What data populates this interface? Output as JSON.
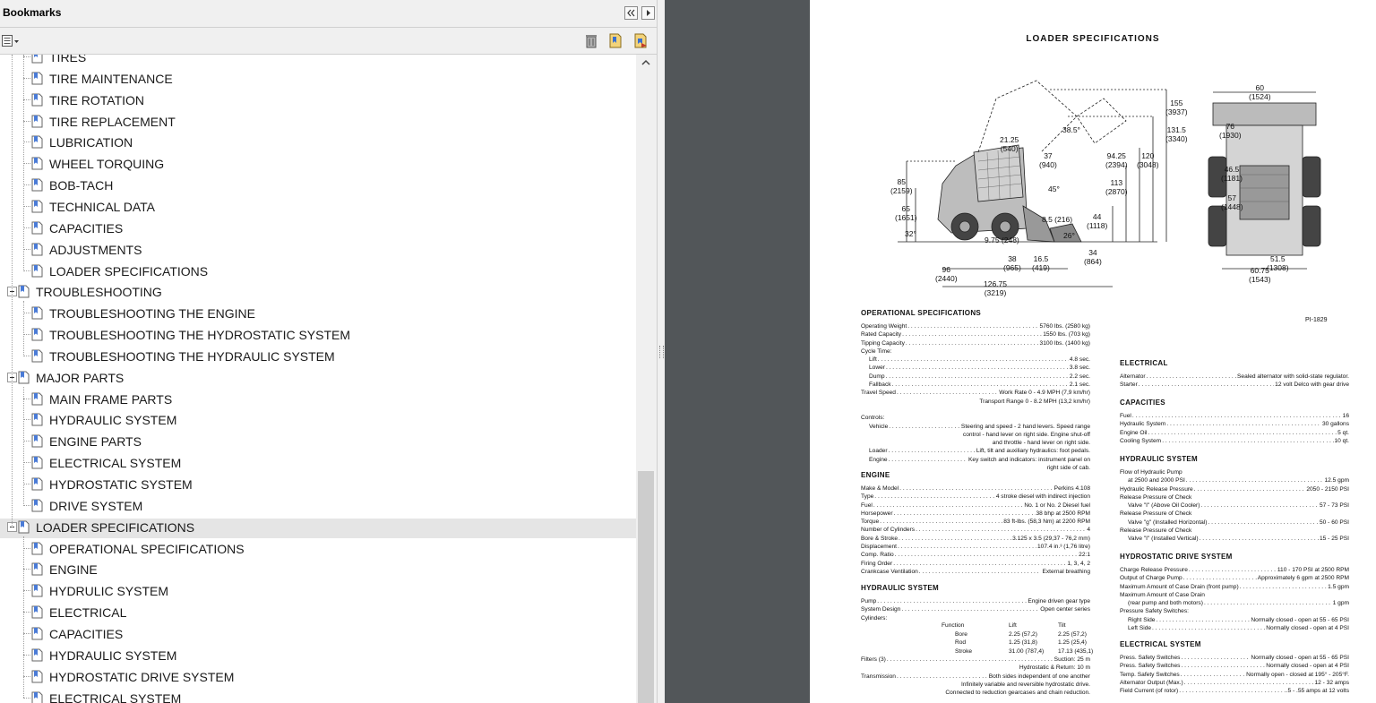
{
  "bookmarks_panel": {
    "title": "Bookmarks",
    "items": [
      {
        "label": "TIRES",
        "level": 1
      },
      {
        "label": "TIRE MAINTENANCE",
        "level": 1
      },
      {
        "label": "TIRE ROTATION",
        "level": 1
      },
      {
        "label": "TIRE REPLACEMENT",
        "level": 1
      },
      {
        "label": "LUBRICATION",
        "level": 1
      },
      {
        "label": "WHEEL TORQUING",
        "level": 1
      },
      {
        "label": "BOB-TACH",
        "level": 1
      },
      {
        "label": "TECHNICAL DATA",
        "level": 1
      },
      {
        "label": "CAPACITIES",
        "level": 1
      },
      {
        "label": "ADJUSTMENTS",
        "level": 1
      },
      {
        "label": "LOADER SPECIFICATIONS",
        "level": 1
      },
      {
        "label": "TROUBLESHOOTING",
        "level": 0
      },
      {
        "label": "TROUBLESHOOTING THE ENGINE",
        "level": 1
      },
      {
        "label": "TROUBLESHOOTING THE HYDROSTATIC SYSTEM",
        "level": 1
      },
      {
        "label": "TROUBLESHOOTING THE HYDRAULIC SYSTEM",
        "level": 1
      },
      {
        "label": "MAJOR PARTS",
        "level": 0
      },
      {
        "label": "MAIN FRAME PARTS",
        "level": 1
      },
      {
        "label": "HYDRAULIC SYSTEM",
        "level": 1
      },
      {
        "label": "ENGINE PARTS",
        "level": 1
      },
      {
        "label": "ELECTRICAL SYSTEM",
        "level": 1
      },
      {
        "label": "HYDROSTATIC SYSTEM",
        "level": 1
      },
      {
        "label": "DRIVE SYSTEM",
        "level": 1
      },
      {
        "label": "LOADER SPECIFICATIONS",
        "level": 0,
        "selected": true
      },
      {
        "label": "OPERATIONAL SPECIFICATIONS",
        "level": 1
      },
      {
        "label": "ENGINE",
        "level": 1
      },
      {
        "label": "HYDRULIC SYSTEM",
        "level": 1
      },
      {
        "label": "ELECTRICAL",
        "level": 1
      },
      {
        "label": "CAPACITIES",
        "level": 1
      },
      {
        "label": "HYDRAULIC SYSTEM",
        "level": 1
      },
      {
        "label": "HYDROSTATIC DRIVE SYSTEM",
        "level": 1
      },
      {
        "label": "ELECTRICAL SYSTEM",
        "level": 1
      }
    ]
  },
  "icons": {
    "options": "options-icon",
    "delete": "trash-icon",
    "new_bookmark": "new-bookmark-icon",
    "bookmark_from_selection": "bookmark-from-selection-icon",
    "collapse": "double-chevron-left-icon",
    "menu": "play-right-icon"
  },
  "document": {
    "title": "LOADER  SPECIFICATIONS",
    "figure_code": "PI-1829",
    "dimensions": [
      {
        "text": "155\n(3937)",
        "l": 397,
        "t": 110
      },
      {
        "text": "131.5\n(3340)",
        "l": 397,
        "t": 140
      },
      {
        "text": "120\n(3048)",
        "l": 365,
        "t": 169
      },
      {
        "text": "94.25\n(2394)",
        "l": 330,
        "t": 169
      },
      {
        "text": "113\n(2870)",
        "l": 330,
        "t": 199
      },
      {
        "text": "38.5°",
        "l": 282,
        "t": 140
      },
      {
        "text": "21.25\n(540)",
        "l": 212,
        "t": 151
      },
      {
        "text": "37\n(940)",
        "l": 256,
        "t": 169
      },
      {
        "text": "45°",
        "l": 266,
        "t": 206
      },
      {
        "text": "85\n(2159)",
        "l": 90,
        "t": 198
      },
      {
        "text": "65\n(1651)",
        "l": 95,
        "t": 228
      },
      {
        "text": "32°",
        "l": 106,
        "t": 256
      },
      {
        "text": "8.5 (216)",
        "l": 259,
        "t": 240
      },
      {
        "text": "44\n(1118)",
        "l": 309,
        "t": 237
      },
      {
        "text": "26°",
        "l": 283,
        "t": 258
      },
      {
        "text": "9.75 (248)",
        "l": 195,
        "t": 263
      },
      {
        "text": "38\n(965)",
        "l": 216,
        "t": 284
      },
      {
        "text": "16.5\n(419)",
        "l": 248,
        "t": 284
      },
      {
        "text": "34\n(864)",
        "l": 306,
        "t": 277
      },
      {
        "text": "96\n(2440)",
        "l": 140,
        "t": 296
      },
      {
        "text": "126.75\n(3219)",
        "l": 194,
        "t": 312
      },
      {
        "text": "60\n(1524)",
        "l": 490,
        "t": 93
      },
      {
        "text": "76\n(1930)",
        "l": 457,
        "t": 136
      },
      {
        "text": "46.5\n(1181)",
        "l": 459,
        "t": 184
      },
      {
        "text": "57\n(1448)",
        "l": 459,
        "t": 216
      },
      {
        "text": "51.5\n(1308)",
        "l": 510,
        "t": 284
      },
      {
        "text": "60.75\n(1543)",
        "l": 490,
        "t": 297
      }
    ],
    "operational": {
      "title": "OPERATIONAL SPECIFICATIONS",
      "rows": [
        {
          "k": "Operating Weight",
          "v": "5760 lbs. (2580 kg)"
        },
        {
          "k": "Rated Capacity",
          "v": "1550 lbs. (703 kg)"
        },
        {
          "k": "Tipping Capacity",
          "v": "3100 lbs. (1400 kg)"
        },
        {
          "k": "Cycle Time:",
          "v": ""
        },
        {
          "k": "Lift",
          "v": "4.8 sec.",
          "indent": true
        },
        {
          "k": "Lower",
          "v": "3.8 sec.",
          "indent": true
        },
        {
          "k": "Dump",
          "v": "2.2 sec.",
          "indent": true
        },
        {
          "k": "Fallback",
          "v": "2.1 sec.",
          "indent": true
        },
        {
          "k": "Travel Speed",
          "v": "Work Rate 0 - 4.9 MPH (7,9 km/hr)"
        },
        {
          "k": "",
          "v": "Transport Range 0 - 8.2 MPH (13,2 km/hr)",
          "cont": true
        },
        {
          "k": "",
          "v": "",
          "cont": true
        },
        {
          "k": "Controls:",
          "v": ""
        },
        {
          "k": "Vehicle",
          "v": "Steering and speed - 2 hand levers. Speed range",
          "indent": true
        },
        {
          "k": "",
          "v": "control - hand lever on right side. Engine shut-off",
          "cont": true
        },
        {
          "k": "",
          "v": "and throttle - hand lever on right side.",
          "cont": true
        },
        {
          "k": "Loader",
          "v": "Lift, tilt and auxiliary hydraulics: foot pedals.",
          "indent": true
        },
        {
          "k": "Engine",
          "v": "Key switch and indicators: instrument panel on",
          "indent": true
        },
        {
          "k": "",
          "v": "right side of cab.",
          "cont": true
        }
      ]
    },
    "engine": {
      "title": "ENGINE",
      "rows": [
        {
          "k": "Make & Model",
          "v": "Perkins 4.108"
        },
        {
          "k": "Type",
          "v": "4 stroke diesel with indirect injection"
        },
        {
          "k": "Fuel",
          "v": "No. 1 or No. 2 Diesel fuel"
        },
        {
          "k": "Horsepower",
          "v": "38 bhp at 2500 RPM"
        },
        {
          "k": "Torque",
          "v": "83 ft-lbs. (58,3 Nm) at 2200 RPM"
        },
        {
          "k": "Number of Cylinders",
          "v": "4"
        },
        {
          "k": "Bore & Stroke",
          "v": "3.125 x 3.5 (29,37 - 76,2 mm)"
        },
        {
          "k": "Displacement",
          "v": "107.4 in.³ (1,76 litre)"
        },
        {
          "k": "Comp. Ratio",
          "v": "22:1"
        },
        {
          "k": "Firing Order",
          "v": "1, 3, 4, 2"
        },
        {
          "k": "Crankcase Ventilation",
          "v": "External breathing"
        }
      ]
    },
    "hydraulic_left": {
      "title": "HYDRAULIC SYSTEM",
      "rows": [
        {
          "k": "Pump",
          "v": "Engine driven gear type"
        },
        {
          "k": "System Design",
          "v": "Open center series"
        },
        {
          "k": "Cylinders:",
          "v": ""
        }
      ],
      "cyl_header": [
        "Function",
        "Lift",
        "Tilt"
      ],
      "cyl_rows": [
        [
          "Bore",
          "2.25 (57,2)",
          "2.25 (57,2)"
        ],
        [
          "Rod",
          "1.25 (31,8)",
          "1.25 (25,4)"
        ],
        [
          "Stroke",
          "31.00 (787,4)",
          "17.13 (435,1)"
        ]
      ],
      "rows2": [
        {
          "k": "Filters (3)",
          "v": "Suction: 25 m"
        },
        {
          "k": "",
          "v": "Hydrostatic & Return: 10 m",
          "cont": true
        },
        {
          "k": "Transmission",
          "v": "Both sides independent of one another"
        },
        {
          "k": "",
          "v": "Infinitely variable and reversible hydrostatic drive.",
          "cont": true
        },
        {
          "k": "",
          "v": "Connected to reduction gearcases and chain reduction.",
          "cont": true
        }
      ]
    },
    "electrical": {
      "title": "ELECTRICAL",
      "rows": [
        {
          "k": "Alternator",
          "v": "Sealed alternator with solid-state regulator."
        },
        {
          "k": "Starter",
          "v": "12 volt Delco with gear drive"
        }
      ]
    },
    "capacities": {
      "title": "CAPACITIES",
      "rows": [
        {
          "k": "Fuel",
          "v": "16"
        },
        {
          "k": "Hydraulic System",
          "v": "30 gallons"
        },
        {
          "k": "Engine Oil",
          "v": "5 qt."
        },
        {
          "k": "Cooling System",
          "v": "10 qt."
        }
      ]
    },
    "hydraulic_right": {
      "title": "HYDRAULIC SYSTEM",
      "rows": [
        {
          "k": "Flow of Hydraulic Pump",
          "v": ""
        },
        {
          "k": "at 2500 and 2000 PSI",
          "v": "12.5 gpm",
          "indent": true
        },
        {
          "k": "Hydraulic Release Pressure",
          "v": "2050 - 2150 PSI"
        },
        {
          "k": "Release Pressure of Check",
          "v": ""
        },
        {
          "k": "Valve \"I\" (Above Oil Cooler)",
          "v": "57 - 73 PSI",
          "indent": true
        },
        {
          "k": "Release Pressure of Check",
          "v": ""
        },
        {
          "k": "Valve \"g\" (Installed Horizontal)",
          "v": "50 - 60 PSI",
          "indent": true
        },
        {
          "k": "Release Pressure of Check",
          "v": ""
        },
        {
          "k": "Valve \"I\" (Installed Vertical)",
          "v": "15 - 25 PSI",
          "indent": true
        }
      ]
    },
    "hydrostatic": {
      "title": "HYDROSTATIC DRIVE SYSTEM",
      "rows": [
        {
          "k": "Charge Release Pressure",
          "v": "110 - 170 PSI at 2500 RPM"
        },
        {
          "k": "Output of Charge Pump",
          "v": "Approximately 6 gpm at 2500 RPM"
        },
        {
          "k": "Maximum Amount of Case Drain (front pump)",
          "v": "1.5 gpm"
        },
        {
          "k": "Maximum Amount of Case Drain",
          "v": ""
        },
        {
          "k": "(rear pump and both motors)",
          "v": "1 gpm",
          "indent": true
        },
        {
          "k": "Pressure Safety Switches:",
          "v": ""
        },
        {
          "k": "Right Side",
          "v": "Normally closed - open at 55 - 65 PSI",
          "indent": true
        },
        {
          "k": "Left Side",
          "v": "Normally closed - open at 4 PSI",
          "indent": true
        }
      ]
    },
    "electrical_system": {
      "title": "ELECTRICAL SYSTEM",
      "rows": [
        {
          "k": "Press. Safety Switches",
          "v": "Normally closed - open at 55 - 65 PSI"
        },
        {
          "k": "Press. Safety Switches",
          "v": "Normally closed - open at 4 PSI"
        },
        {
          "k": "Temp. Safety Switches",
          "v": "Normally open - closed at 195° - 205°F."
        },
        {
          "k": "Alternator Output (Max.)",
          "v": "12 - 32 amps"
        },
        {
          "k": "Field Current (of rotor)",
          "v": ".5 - .55 amps at 12 volts"
        }
      ]
    }
  }
}
